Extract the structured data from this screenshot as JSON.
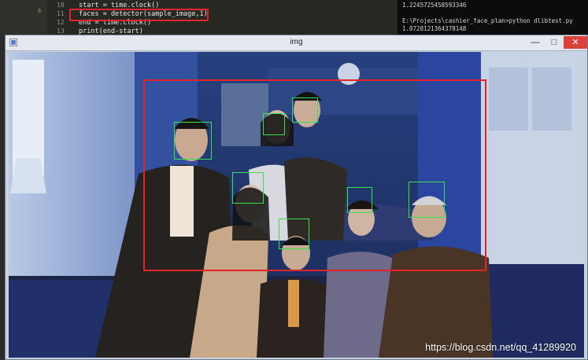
{
  "editor": {
    "marker": "6",
    "lines": [
      {
        "num": "10",
        "code": "start = time.clock()"
      },
      {
        "num": "11",
        "code": "faces = detector(sample_image,1)"
      },
      {
        "num": "12",
        "code": "end = time.clock()"
      },
      {
        "num": "13",
        "code": "print(end-start)"
      }
    ]
  },
  "terminal": {
    "lines": [
      "1.2245725458593346",
      "",
      "E:\\Projects\\cashier_face_plan>python dlibtest.py",
      "1.0728121364378148"
    ]
  },
  "window": {
    "title": "img",
    "controls": {
      "minimize": "—",
      "maximize": "□",
      "close": "✕"
    }
  },
  "watermark": "https://blog.csdn.net/qq_41289920",
  "colors": {
    "detection_box": "#e42326",
    "face_box": "#36e34a",
    "close_button": "#d9423a"
  }
}
